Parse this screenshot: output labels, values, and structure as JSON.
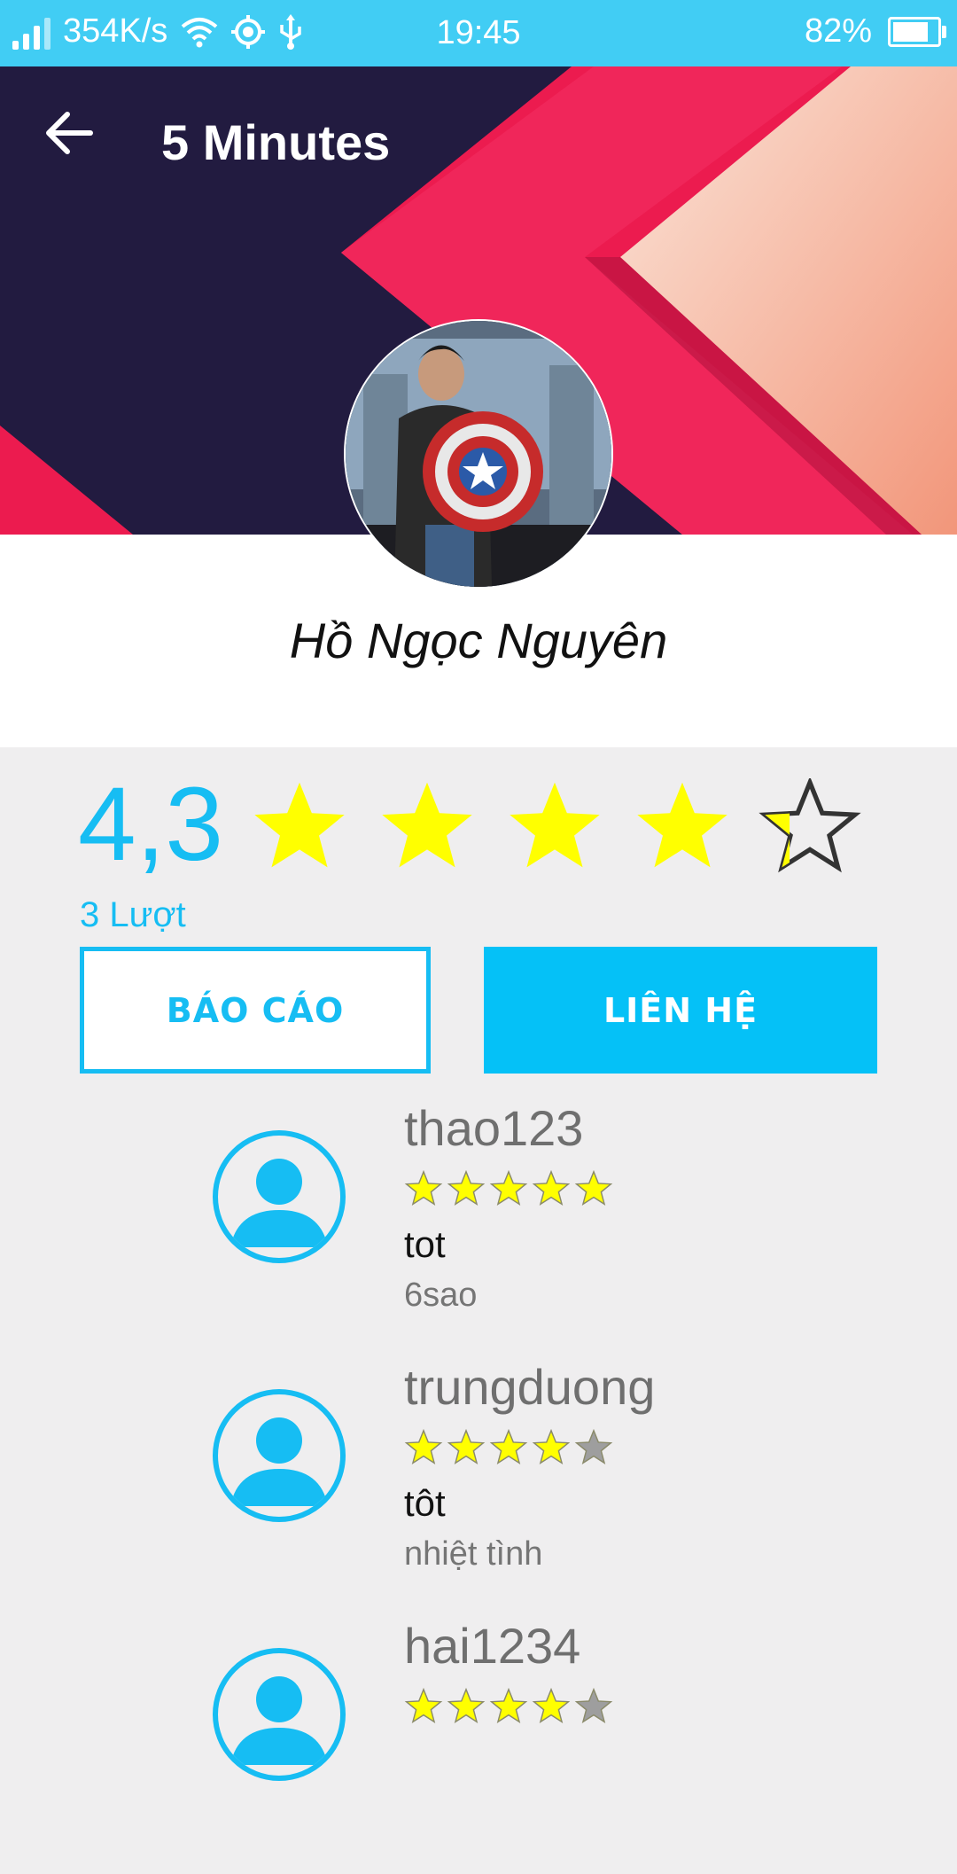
{
  "status_bar": {
    "speed": "354K/s",
    "time": "19:45",
    "battery": "82%",
    "battery_level": 0.82,
    "icons": [
      "signal-icon",
      "wifi-icon",
      "location-icon",
      "usb-icon",
      "battery-icon"
    ]
  },
  "header": {
    "title": "5 Minutes",
    "back_icon": "arrow-left-icon"
  },
  "profile": {
    "name": "Hồ Ngọc Nguyên"
  },
  "rating": {
    "score": "4,3",
    "score_value": 4.3,
    "count": "3 Lượt"
  },
  "actions": {
    "report_label": "BÁO CÁO",
    "contact_label": "LIÊN HỆ"
  },
  "reviews": [
    {
      "user": "thao123",
      "stars": 5,
      "comment": "tot",
      "detail": "6sao"
    },
    {
      "user": "trungduong",
      "stars": 4,
      "comment": "tôt",
      "detail": "nhiệt tình"
    },
    {
      "user": "hai1234",
      "stars": 4,
      "comment": "",
      "detail": ""
    }
  ],
  "colors": {
    "accent": "#16bdf3",
    "status_bar": "#41cdf4",
    "star_fill": "#ffff00",
    "star_empty": "#9e9e9e"
  }
}
